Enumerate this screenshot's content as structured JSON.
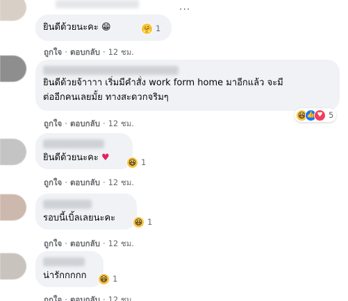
{
  "actions": {
    "like": "ถูกใจ",
    "reply": "ตอบกลับ",
    "time": "12 ชม.",
    "dot": "·"
  },
  "comments": [
    {
      "text": "ยินดีด้วยนะคะ",
      "emoji": "😁",
      "reaction": {
        "icons": [
          "care-icon"
        ],
        "count": "1"
      }
    },
    {
      "text_line1": "ยินดีด้วยจ้าาาา เริ่มมีคำสั่ง work form home มาอีกแล้ว จะมี",
      "text_line2": "ต่ออีกคนเลยมั้ย ทางสะดวกจริมๆ",
      "reaction": {
        "icons": [
          "haha-icon",
          "like-icon",
          "love-icon"
        ],
        "count": "5"
      }
    },
    {
      "text": "ยินดีด้วยนะคะ",
      "emoji": "❤️",
      "reaction": {
        "icons": [
          "haha-icon"
        ],
        "count": "1"
      }
    },
    {
      "text": "รอบนี้เบิ้ลเลยนะคะ",
      "reaction": {
        "icons": [
          "haha-icon"
        ],
        "count": "1"
      }
    },
    {
      "text": "น่ารักกกกก",
      "reaction": {
        "icons": [
          "haha-icon"
        ],
        "count": "1"
      }
    }
  ],
  "more_options": "···",
  "colors": {
    "bubble": "#f0f2f5",
    "meta": "#65676b",
    "like": "#1877f2",
    "love": "#f33e58",
    "haha": "#f7b125"
  }
}
